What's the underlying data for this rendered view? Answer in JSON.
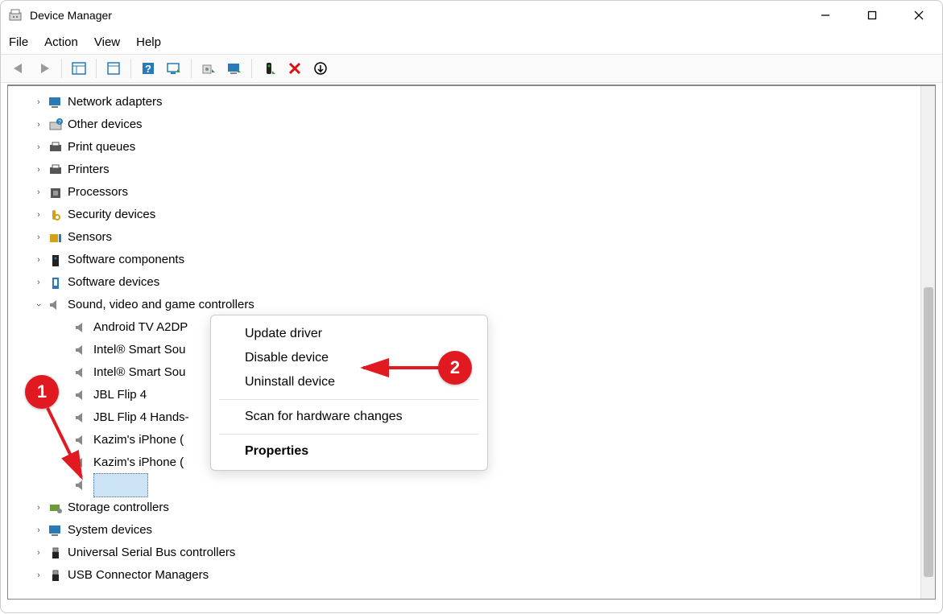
{
  "window": {
    "title": "Device Manager"
  },
  "menu": {
    "file": "File",
    "action": "Action",
    "view": "View",
    "help": "Help"
  },
  "tree": {
    "items": [
      "Network adapters",
      "Other devices",
      "Print queues",
      "Printers",
      "Processors",
      "Security devices",
      "Sensors",
      "Software components",
      "Software devices"
    ],
    "sound_label": "Sound, video and game controllers",
    "sound_children": [
      "Android TV A2DP",
      "Intel® Smart Sou",
      "Intel® Smart Sou",
      "JBL Flip 4",
      "JBL Flip 4 Hands-",
      "Kazim's iPhone (",
      "Kazim's iPhone ("
    ],
    "after_items": [
      "Storage controllers",
      "System devices",
      "Universal Serial Bus controllers",
      "USB Connector Managers"
    ]
  },
  "context_menu": {
    "update": "Update driver",
    "disable": "Disable device",
    "uninstall": "Uninstall device",
    "scan": "Scan for hardware changes",
    "properties": "Properties"
  },
  "annotations": {
    "badge1": "1",
    "badge2": "2"
  }
}
